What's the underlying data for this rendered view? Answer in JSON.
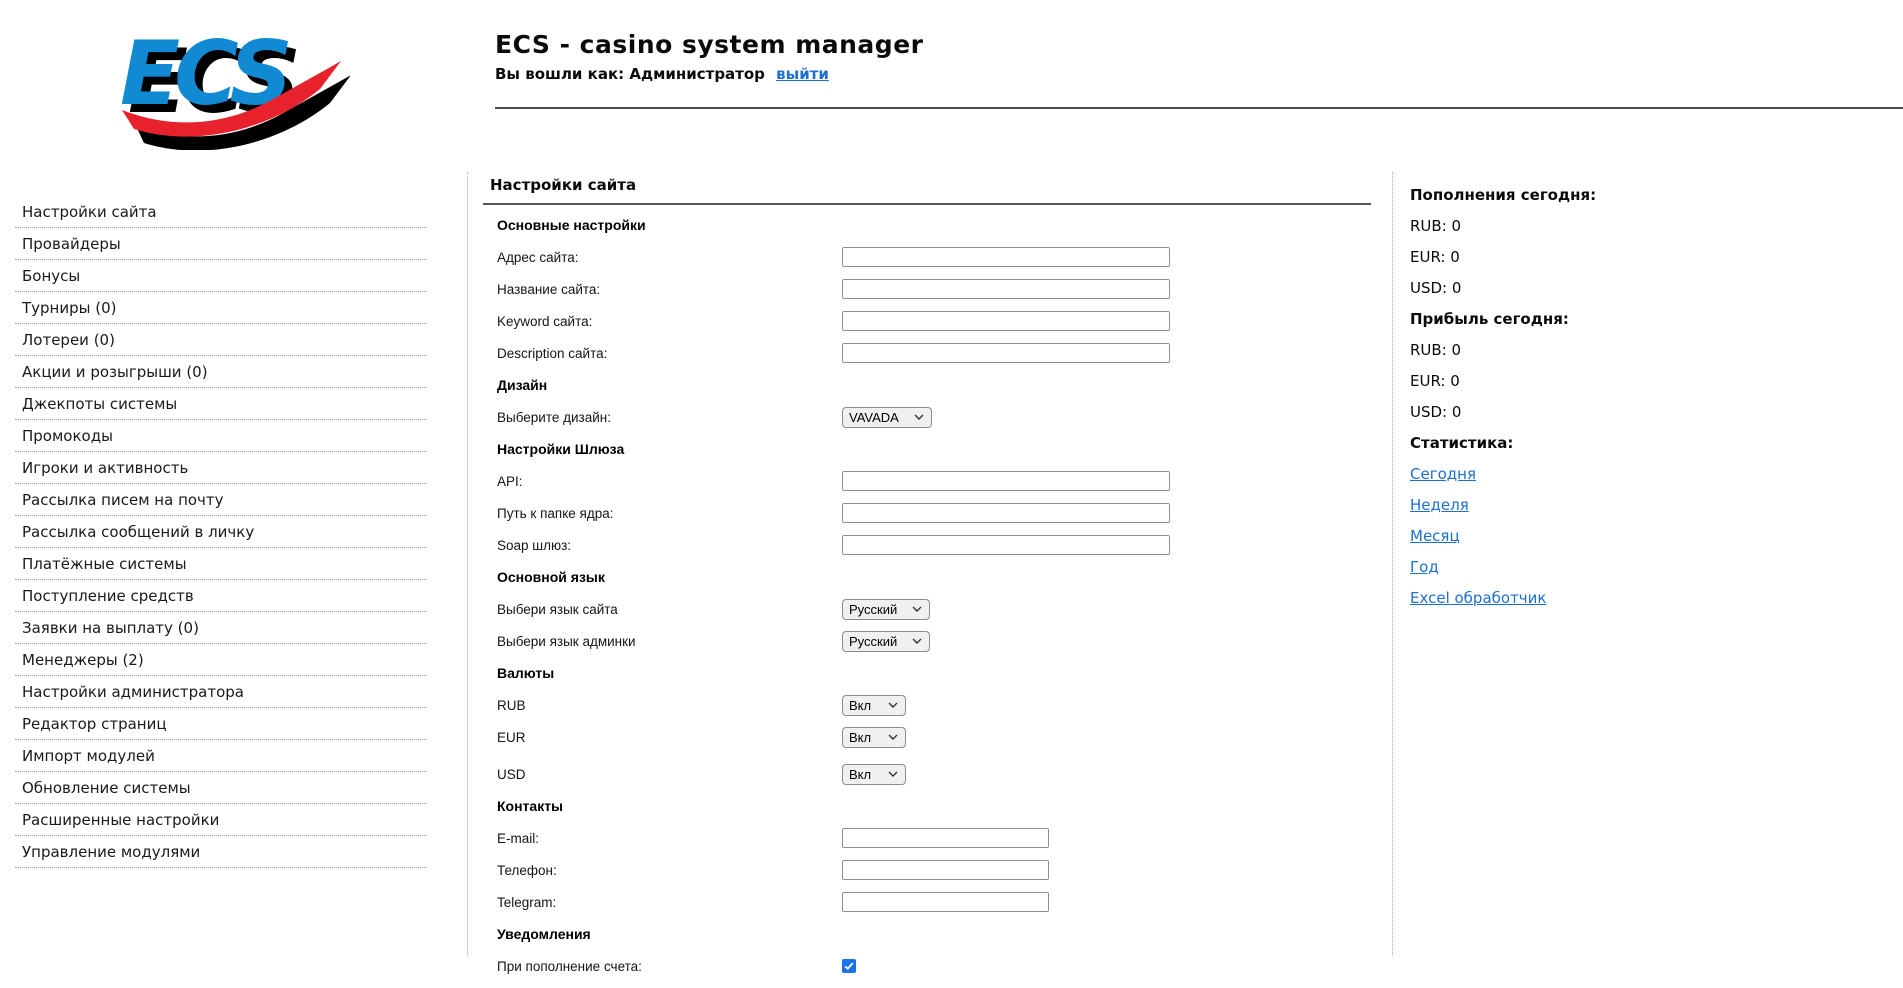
{
  "logo": {
    "text": "ECS",
    "blue": "#1289d3",
    "red": "#e8222d",
    "shadow": "#000000"
  },
  "header": {
    "title": "ECS - casino system manager",
    "login_prefix": "Вы вошли как: Администратор",
    "logout_label": "выйти"
  },
  "sidebar": {
    "items": [
      {
        "name": "site-settings",
        "label": "Настройки сайта"
      },
      {
        "name": "providers",
        "label": "Провайдеры"
      },
      {
        "name": "bonuses",
        "label": "Бонусы"
      },
      {
        "name": "tournaments",
        "label": "Турниры (0)"
      },
      {
        "name": "lotteries",
        "label": "Лотереи (0)"
      },
      {
        "name": "promotions",
        "label": "Акции и розыгрыши (0)"
      },
      {
        "name": "system-jackpots",
        "label": "Джекпоты системы"
      },
      {
        "name": "promo-codes",
        "label": "Промокоды"
      },
      {
        "name": "players-activity",
        "label": "Игроки и активность"
      },
      {
        "name": "email-mailing",
        "label": "Рассылка писем на почту"
      },
      {
        "name": "pm-mailing",
        "label": "Рассылка сообщений в личку"
      },
      {
        "name": "payment-systems",
        "label": "Платёжные системы"
      },
      {
        "name": "incoming-funds",
        "label": "Поступление средств"
      },
      {
        "name": "payout-requests",
        "label": "Заявки на выплату (0)"
      },
      {
        "name": "managers",
        "label": "Менеджеры (2)"
      },
      {
        "name": "admin-settings",
        "label": "Настройки администратора"
      },
      {
        "name": "page-editor",
        "label": "Редактор страниц"
      },
      {
        "name": "module-import",
        "label": "Импорт модулей"
      },
      {
        "name": "system-update",
        "label": "Обновление системы"
      },
      {
        "name": "advanced-settings",
        "label": "Расширенные настройки"
      },
      {
        "name": "module-management",
        "label": "Управление модулями"
      }
    ]
  },
  "main": {
    "title": "Настройки сайта",
    "rows": [
      {
        "type": "section",
        "name": "section-basic-settings",
        "label": "Основные настройки"
      },
      {
        "type": "text",
        "name": "site-address",
        "label": "Адрес сайта:",
        "value": "",
        "width": "wide"
      },
      {
        "type": "text",
        "name": "site-name",
        "label": "Название сайта:",
        "value": "",
        "width": "wide"
      },
      {
        "type": "text",
        "name": "site-keyword",
        "label": "Keyword сайта:",
        "value": "",
        "width": "wide"
      },
      {
        "type": "text",
        "name": "site-description",
        "label": "Description сайта:",
        "value": "",
        "width": "wide"
      },
      {
        "type": "section",
        "name": "section-design",
        "label": "Дизайн"
      },
      {
        "type": "select",
        "name": "design",
        "label": "Выберите дизайн:",
        "value": "VAVADA",
        "select_width": 90
      },
      {
        "type": "section",
        "name": "section-gateway",
        "label": "Настройки Шлюза"
      },
      {
        "type": "text",
        "name": "api",
        "label": "API:",
        "value": "",
        "width": "wide"
      },
      {
        "type": "text",
        "name": "core-folder-path",
        "label": "Путь к папке ядра:",
        "value": "",
        "width": "wide"
      },
      {
        "type": "text",
        "name": "soap-gateway",
        "label": "Soap шлюз:",
        "value": "",
        "width": "wide"
      },
      {
        "type": "section",
        "name": "section-main-language",
        "label": "Основной язык"
      },
      {
        "type": "select",
        "name": "site-language",
        "label": "Выбери язык сайта",
        "value": "Русский",
        "select_width": 88
      },
      {
        "type": "select",
        "name": "admin-language",
        "label": "Выбери язык админки",
        "value": "Русский",
        "select_width": 88
      },
      {
        "type": "section",
        "name": "section-currencies",
        "label": "Валюты"
      },
      {
        "type": "select",
        "name": "currency-rub",
        "label": "RUB",
        "value": "Вкл",
        "select_width": 64
      },
      {
        "type": "select",
        "name": "currency-eur",
        "label": "EUR",
        "value": "Вкл",
        "select_width": 64
      },
      {
        "type": "select",
        "name": "currency-usd",
        "label": "USD",
        "value": "Вкл",
        "select_width": 64
      },
      {
        "type": "section",
        "name": "section-contacts",
        "label": "Контакты"
      },
      {
        "type": "text",
        "name": "email",
        "label": "E-mail:",
        "value": "",
        "width": "narrow"
      },
      {
        "type": "text",
        "name": "phone",
        "label": "Телефон:",
        "value": "",
        "width": "narrow"
      },
      {
        "type": "text",
        "name": "telegram",
        "label": "Telegram:",
        "value": "",
        "width": "narrow"
      },
      {
        "type": "section",
        "name": "section-notifications",
        "label": "Уведомления"
      },
      {
        "type": "checkbox",
        "name": "notify-on-deposit",
        "label": "При пополнение счета:",
        "checked": true
      }
    ]
  },
  "stats": {
    "deposits_title": "Пополнения сегодня:",
    "deposits": [
      {
        "currency": "RUB",
        "amount": "0"
      },
      {
        "currency": "EUR",
        "amount": "0"
      },
      {
        "currency": "USD",
        "amount": "0"
      }
    ],
    "profit_title": "Прибыль сегодня:",
    "profit": [
      {
        "currency": "RUB",
        "amount": "0"
      },
      {
        "currency": "EUR",
        "amount": "0"
      },
      {
        "currency": "USD",
        "amount": "0"
      }
    ],
    "stats_title": "Статистика:",
    "links": [
      {
        "name": "stats-today",
        "label": "Сегодня"
      },
      {
        "name": "stats-week",
        "label": "Неделя"
      },
      {
        "name": "stats-month",
        "label": "Месяц"
      },
      {
        "name": "stats-year",
        "label": "Год"
      },
      {
        "name": "excel-handler",
        "label": "Excel обработчик"
      }
    ],
    "link_color": "#1d6fd1",
    "checkbox_color": "#1a73e8"
  }
}
